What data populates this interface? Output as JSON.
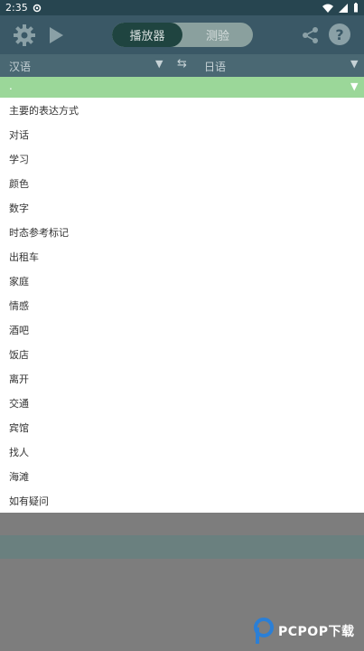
{
  "status_bar": {
    "time": "2:35"
  },
  "toolbar": {
    "mode_tabs": [
      "播放器",
      "测验"
    ],
    "help_label": "?"
  },
  "language_bar": {
    "source": "汉语",
    "target": "日语",
    "swap_symbol": "⇆"
  },
  "category_dropdown": {
    "selected": "."
  },
  "menu": {
    "items": [
      "主要的表达方式",
      "对话",
      "学习",
      "颜色",
      "数字",
      "时态参考标记",
      "出租车",
      "家庭",
      "情感",
      "酒吧",
      "饭店",
      "离开",
      "交通",
      "宾馆",
      "找人",
      "海滩",
      "如有疑问"
    ]
  },
  "watermark": {
    "text": "PCPOP下载"
  },
  "colors": {
    "toolbar": "#3a5866",
    "language_bar": "#4a6873",
    "dropdown_accent": "#9bd799",
    "active_tab": "#1f4440"
  }
}
